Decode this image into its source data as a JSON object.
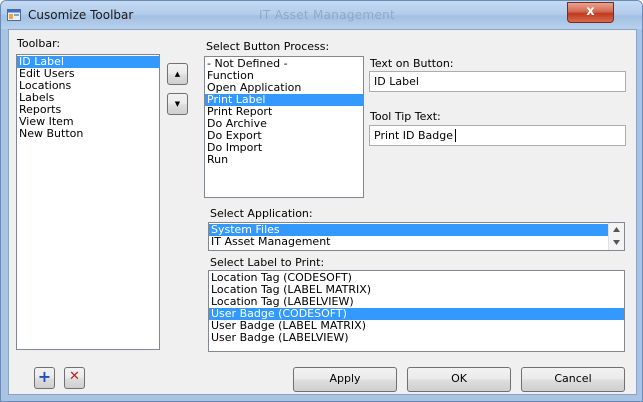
{
  "window": {
    "title": "Cusomize Toolbar",
    "background_title": "IT Asset Management"
  },
  "toolbar_list": {
    "label": "Toolbar:",
    "items": [
      "ID Label",
      "Edit Users",
      "Locations",
      "Labels",
      "Reports",
      "View Item",
      "New Button"
    ],
    "selected_index": 0
  },
  "process_list": {
    "label": "Select Button Process:",
    "items": [
      "- Not Defined -",
      "Function",
      "Open Application",
      "Print Label",
      "Print Report",
      "Do Archive",
      "Do Export",
      "Do Import",
      "Run"
    ],
    "selected_index": 3
  },
  "text_on_button": {
    "label": "Text on Button:",
    "value": "ID Label"
  },
  "tool_tip": {
    "label": "Tool Tip Text:",
    "value": "Print ID Badge"
  },
  "application_list": {
    "label": "Select Application:",
    "items": [
      "System Files",
      "IT Asset Management"
    ],
    "selected_index": 0
  },
  "label_list": {
    "label": "Select Label to Print:",
    "items": [
      "Location Tag (CODESOFT)",
      "Location Tag (LABEL MATRIX)",
      "Location Tag (LABELVIEW)",
      "User Badge (CODESOFT)",
      "User Badge (LABEL MATRIX)",
      "User Badge (LABELVIEW)"
    ],
    "selected_index": 3
  },
  "buttons": {
    "apply": "Apply",
    "ok": "OK",
    "cancel": "Cancel"
  },
  "icons": {
    "move_up": "▲",
    "move_down": "▼",
    "add": "+",
    "delete": "✕",
    "close": "x"
  },
  "colors": {
    "selection": "#3399ff",
    "add_icon": "#1f4fbf",
    "delete_icon": "#d01818"
  }
}
